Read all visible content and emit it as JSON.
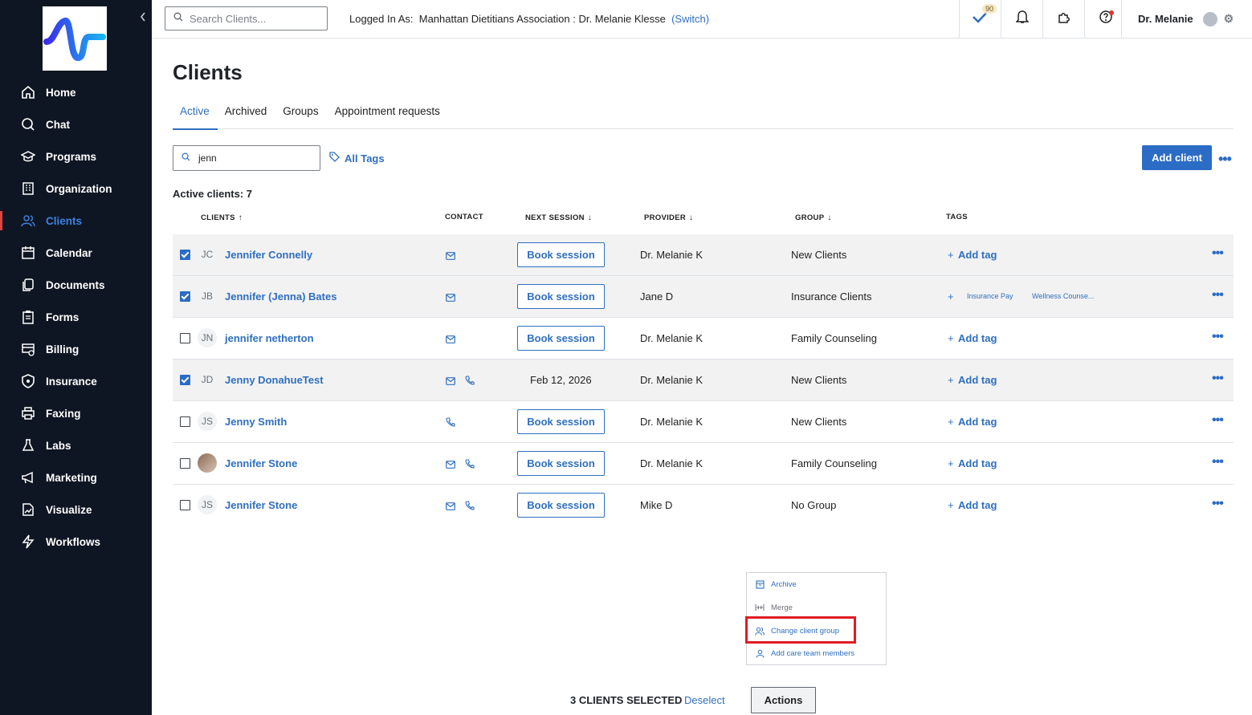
{
  "sidebar": {
    "collapse_icon": "chevron-left-icon",
    "items": [
      {
        "label": "Home",
        "icon": "home-icon"
      },
      {
        "label": "Chat",
        "icon": "chat-icon"
      },
      {
        "label": "Programs",
        "icon": "graduation-cap-icon"
      },
      {
        "label": "Organization",
        "icon": "building-icon"
      },
      {
        "label": "Clients",
        "icon": "users-icon",
        "active": true
      },
      {
        "label": "Calendar",
        "icon": "calendar-icon"
      },
      {
        "label": "Documents",
        "icon": "documents-icon"
      },
      {
        "label": "Forms",
        "icon": "clipboard-icon"
      },
      {
        "label": "Billing",
        "icon": "billing-icon"
      },
      {
        "label": "Insurance",
        "icon": "shield-icon"
      },
      {
        "label": "Faxing",
        "icon": "printer-icon"
      },
      {
        "label": "Labs",
        "icon": "flask-icon"
      },
      {
        "label": "Marketing",
        "icon": "megaphone-icon"
      },
      {
        "label": "Visualize",
        "icon": "chart-icon"
      },
      {
        "label": "Workflows",
        "icon": "lightning-icon"
      }
    ]
  },
  "topbar": {
    "search_placeholder": "Search Clients...",
    "logged_in_label": "Logged In As:",
    "logged_in_org": "Manhattan Dietitians Association : Dr. Melanie Klesse",
    "switch_label": "(Switch)",
    "tasks_badge": "90",
    "user_name": "Dr. Melanie"
  },
  "page": {
    "title": "Clients",
    "tabs": [
      "Active",
      "Archived",
      "Groups",
      "Appointment requests"
    ],
    "filter_value": "jenn",
    "all_tags_label": "All Tags",
    "add_client_label": "Add client",
    "active_count_label": "Active clients: 7"
  },
  "table": {
    "headers": {
      "clients": "CLIENTS",
      "contact": "CONTACT",
      "next_session": "NEXT SESSION",
      "provider": "PROVIDER",
      "group": "GROUP",
      "tags": "TAGS"
    },
    "book_label": "Book session",
    "add_tag_label": "Add tag",
    "rows": [
      {
        "checked": true,
        "initials": "JC",
        "name": "Jennifer Connelly",
        "contact": [
          "email"
        ],
        "next": "",
        "provider": "Dr. Melanie K",
        "group": "New Clients",
        "tags": []
      },
      {
        "checked": true,
        "initials": "JB",
        "name": "Jennifer (Jenna) Bates",
        "contact": [
          "email"
        ],
        "next": "",
        "provider": "Jane D",
        "group": "Insurance Clients",
        "tags": [
          "Insurance Pay",
          "Wellness Counse..."
        ]
      },
      {
        "checked": false,
        "initials": "JN",
        "name": "jennifer netherton",
        "contact": [
          "email"
        ],
        "next": "",
        "provider": "Dr. Melanie K",
        "group": "Family Counseling",
        "tags": []
      },
      {
        "checked": true,
        "initials": "JD",
        "name": "Jenny DonahueTest",
        "contact": [
          "email",
          "phone"
        ],
        "next": "Feb 12, 2026",
        "provider": "Dr. Melanie K",
        "group": "New Clients",
        "tags": []
      },
      {
        "checked": false,
        "initials": "JS",
        "name": "Jenny Smith",
        "contact": [
          "phone"
        ],
        "next": "",
        "provider": "Dr. Melanie K",
        "group": "New Clients",
        "tags": []
      },
      {
        "checked": false,
        "initials": "",
        "photo": true,
        "name": "Jennifer Stone",
        "contact": [
          "email",
          "phone"
        ],
        "next": "",
        "provider": "Dr. Melanie K",
        "group": "Family Counseling",
        "tags": []
      },
      {
        "checked": false,
        "initials": "JS",
        "name": "Jennifer Stone",
        "contact": [
          "email",
          "phone"
        ],
        "next": "",
        "provider": "Mike D",
        "group": "No Group",
        "tags": []
      }
    ]
  },
  "actions_menu": {
    "items": [
      {
        "label": "Archive",
        "icon": "archive-icon",
        "enabled": true
      },
      {
        "label": "Merge",
        "icon": "merge-icon",
        "enabled": false
      },
      {
        "label": "Change client group",
        "icon": "users-icon",
        "enabled": true
      },
      {
        "label": "Add care team members",
        "icon": "user-icon",
        "enabled": true
      }
    ]
  },
  "footer": {
    "selected_label": "3 CLIENTS SELECTED",
    "deselect_label": "Deselect",
    "actions_label": "Actions"
  },
  "colors": {
    "sidebar_bg": "#0f1623",
    "accent": "#2b6cc4",
    "highlight": "#e01b24"
  }
}
